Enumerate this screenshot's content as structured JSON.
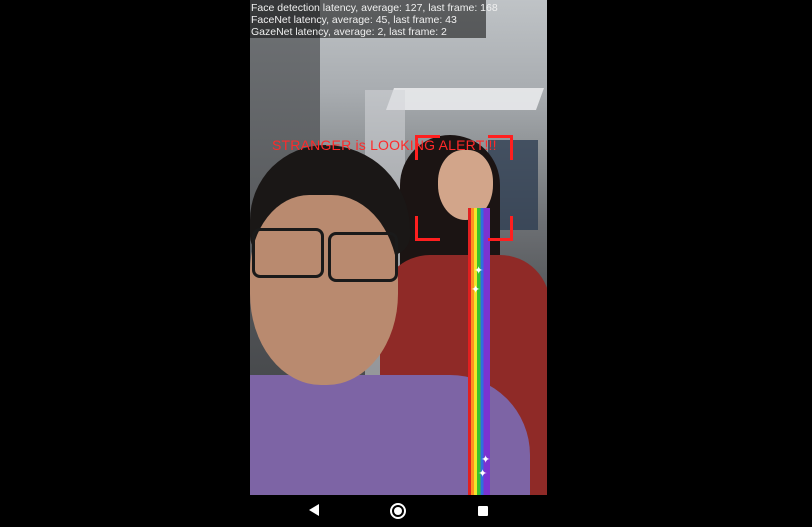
{
  "overlay": {
    "face_detection": "Face detection latency, average: 127, last frame: 168",
    "facenet": "FaceNet latency, average: 45, last frame: 43",
    "gazenet": "GazeNet latency, average: 2, last frame: 2"
  },
  "alert": {
    "text": "STRANGER is LOOKING ALERT!!!",
    "color": "#ff2a2a"
  },
  "face_box_color": "#ff1f1f",
  "nav": {
    "back_icon": "back-triangle-icon",
    "home_icon": "home-circle-icon",
    "recents_icon": "recents-square-icon"
  }
}
